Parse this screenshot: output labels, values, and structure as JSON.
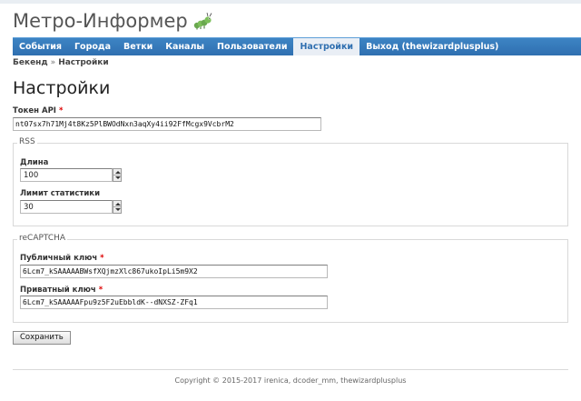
{
  "header": {
    "title": "Метро-Информер",
    "logo_icon": "caterpillar-icon"
  },
  "nav": {
    "items": [
      {
        "label": "События"
      },
      {
        "label": "Города"
      },
      {
        "label": "Ветки"
      },
      {
        "label": "Каналы"
      },
      {
        "label": "Пользователи"
      },
      {
        "label": "Настройки",
        "active": true
      },
      {
        "label": "Выход (thewizardplusplus)"
      }
    ],
    "accent_color": "#2f6fb0"
  },
  "breadcrumb": {
    "root": "Бекенд",
    "separator": "»",
    "current": "Настройки"
  },
  "page_title": "Настройки",
  "form": {
    "api_token": {
      "label": "Токен API",
      "required_mark": "*",
      "value": "nt07sx7h71Mj4t8Kz5PlBWOdNxn3aqXy4ii92FfMcgx9VcbrM2"
    },
    "rss": {
      "legend": "RSS",
      "length": {
        "label": "Длина",
        "value": "100"
      },
      "stats_limit": {
        "label": "Лимит статистики",
        "value": "30"
      }
    },
    "recaptcha": {
      "legend": "reCAPTCHA",
      "public_key": {
        "label": "Публичный ключ",
        "required_mark": "*",
        "value": "6Lcm7_kSAAAAABWsfXQjmzXlc867ukoIpLi5m9X2"
      },
      "private_key": {
        "label": "Приватный ключ",
        "required_mark": "*",
        "value": "6Lcm7_kSAAAAAFpu9z5F2uEbbldK--dNXSZ-ZFq1"
      }
    },
    "save_label": "Сохранить"
  },
  "footer": {
    "copyright": "Copyright © 2015-2017 irenica, dcoder_mm, thewizardplusplus"
  }
}
